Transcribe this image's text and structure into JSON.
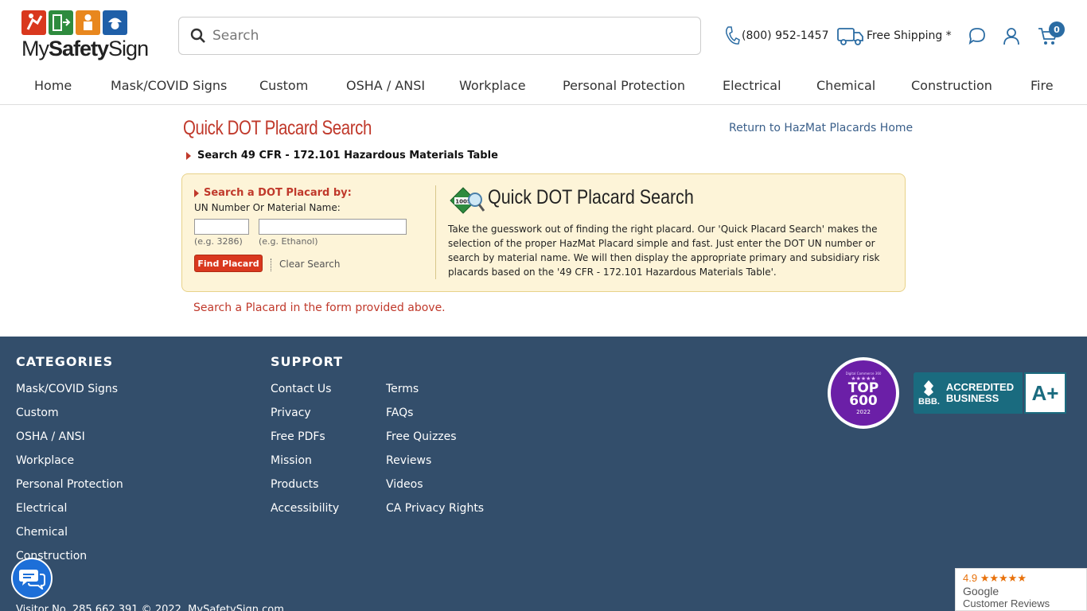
{
  "header": {
    "logo_text_normal": "My",
    "logo_text_bold": "Safety",
    "logo_text_end": "Sign",
    "search_placeholder": "Search",
    "phone": "(800) 952-1457",
    "shipping": "Free Shipping *",
    "cart_count": "0",
    "icons": [
      "search-icon",
      "phone-icon",
      "truck-icon",
      "chat-icon",
      "account-icon",
      "cart-icon"
    ]
  },
  "nav": [
    "Home",
    "Mask/COVID Signs",
    "Custom",
    "OSHA / ANSI",
    "Workplace",
    "Personal Protection",
    "Electrical",
    "Chemical",
    "Construction",
    "Fire"
  ],
  "main": {
    "title": "Quick DOT Placard Search",
    "return_link": "Return to HazMat Placards Home",
    "cfr_link": "Search 49 CFR - 172.101 Hazardous Materials Table",
    "panel": {
      "label": "Search a DOT Placard by:",
      "sub": "UN Number Or Material Name:",
      "eg_un": "(e.g. 3286)",
      "eg_material": "(e.g. Ethanol)",
      "find_button": "Find Placard",
      "clear_link": "Clear Search",
      "icon_number": "1005",
      "heading": "Quick DOT Placard Search",
      "description": "Take the guesswork out of finding the right placard. Our 'Quick Placard Search' makes the selection of the proper HazMat Placard simple and fast. Just enter the DOT UN number or search by material name. We will then display the appropriate primary and subsidiary risk placards based on the '49 CFR - 172.101 Hazardous Materials Table'."
    },
    "note": "Search a Placard in the form provided above."
  },
  "footer": {
    "categories_heading": "CATEGORIES",
    "categories": [
      "Mask/COVID Signs",
      "Custom",
      "OSHA / ANSI",
      "Workplace",
      "Personal Protection",
      "Electrical",
      "Chemical",
      "Construction"
    ],
    "support_heading": "SUPPORT",
    "support_col1": [
      "Contact Us",
      "Privacy",
      "Free PDFs",
      "Mission",
      "Products",
      "Accessibility"
    ],
    "support_col2": [
      "Terms",
      "FAQs",
      "Free Quizzes",
      "Reviews",
      "Videos",
      "CA Privacy Rights"
    ],
    "badge_top_title": "TOP",
    "badge_top_number": "600",
    "badge_top_year": "2022",
    "badge_top_small": "Digital Commerce 360",
    "bbb_label": "BBB.",
    "bbb_text1": "ACCREDITED",
    "bbb_text2": "BUSINESS",
    "bbb_grade": "A+",
    "visitor": "Visitor No. 285,662,391 © 2022, MySafetySign.com",
    "google_rating": "4.9",
    "google_stars": "★★★★★",
    "google_label": "Google",
    "google_reviews": "Customer Reviews"
  },
  "colors": {
    "accent_red": "#c0392b",
    "footer_bg": "#334e6b",
    "link_blue": "#3a5f8a",
    "panel_bg": "#fdf4d8"
  }
}
